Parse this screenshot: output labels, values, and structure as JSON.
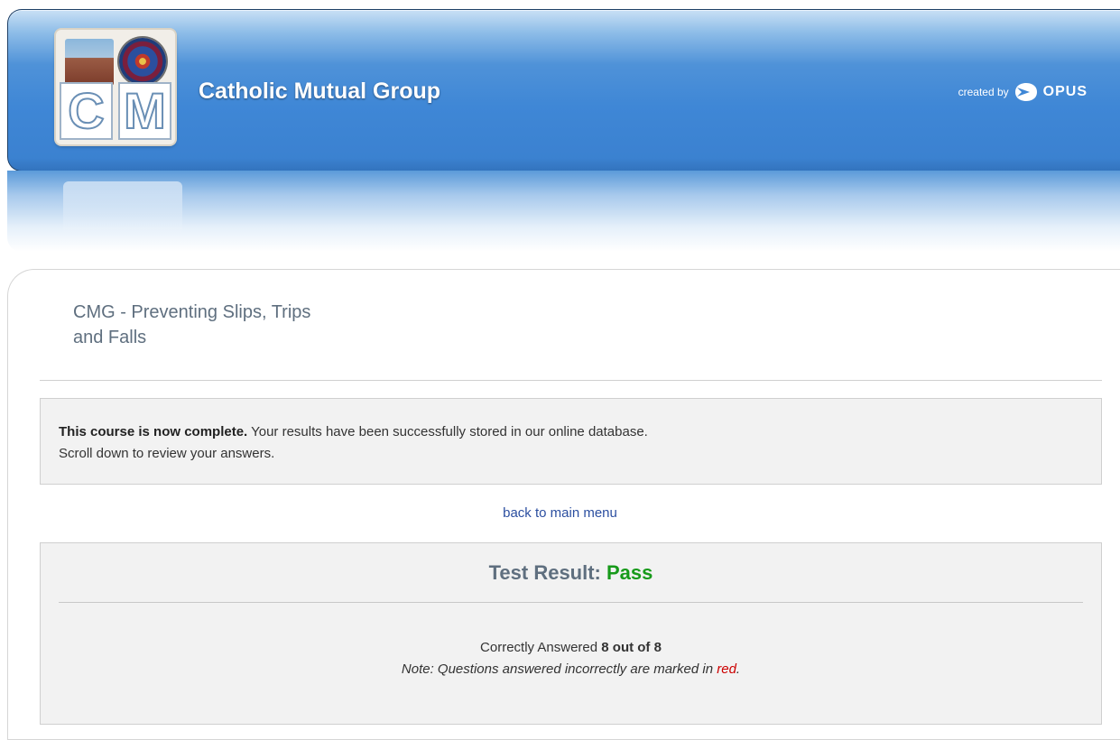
{
  "header": {
    "title": "Catholic Mutual Group",
    "logo_letters": [
      "C",
      "M"
    ],
    "created_by_label": "created by",
    "created_by_brand": "OPUS"
  },
  "course": {
    "title_line1": "CMG - Preventing Slips, Trips",
    "title_line2": "and Falls"
  },
  "notice": {
    "bold_text": "This course is now complete.",
    "text": " Your results have been successfully stored in our online database.",
    "line2": "Scroll down to review your answers."
  },
  "nav": {
    "back_link": "back to main menu"
  },
  "result": {
    "heading_label": "Test Result: ",
    "status": "Pass",
    "score_label": "Correctly Answered ",
    "score_value": "8 out of 8",
    "note_prefix": "Note: Questions answered incorrectly are marked in ",
    "note_red_word": "red",
    "note_suffix": "."
  },
  "colors": {
    "banner_blue": "#3f87d6",
    "pass_green": "#179a1a",
    "incorrect_red": "#cc0000",
    "link_blue": "#2c4fa0"
  }
}
